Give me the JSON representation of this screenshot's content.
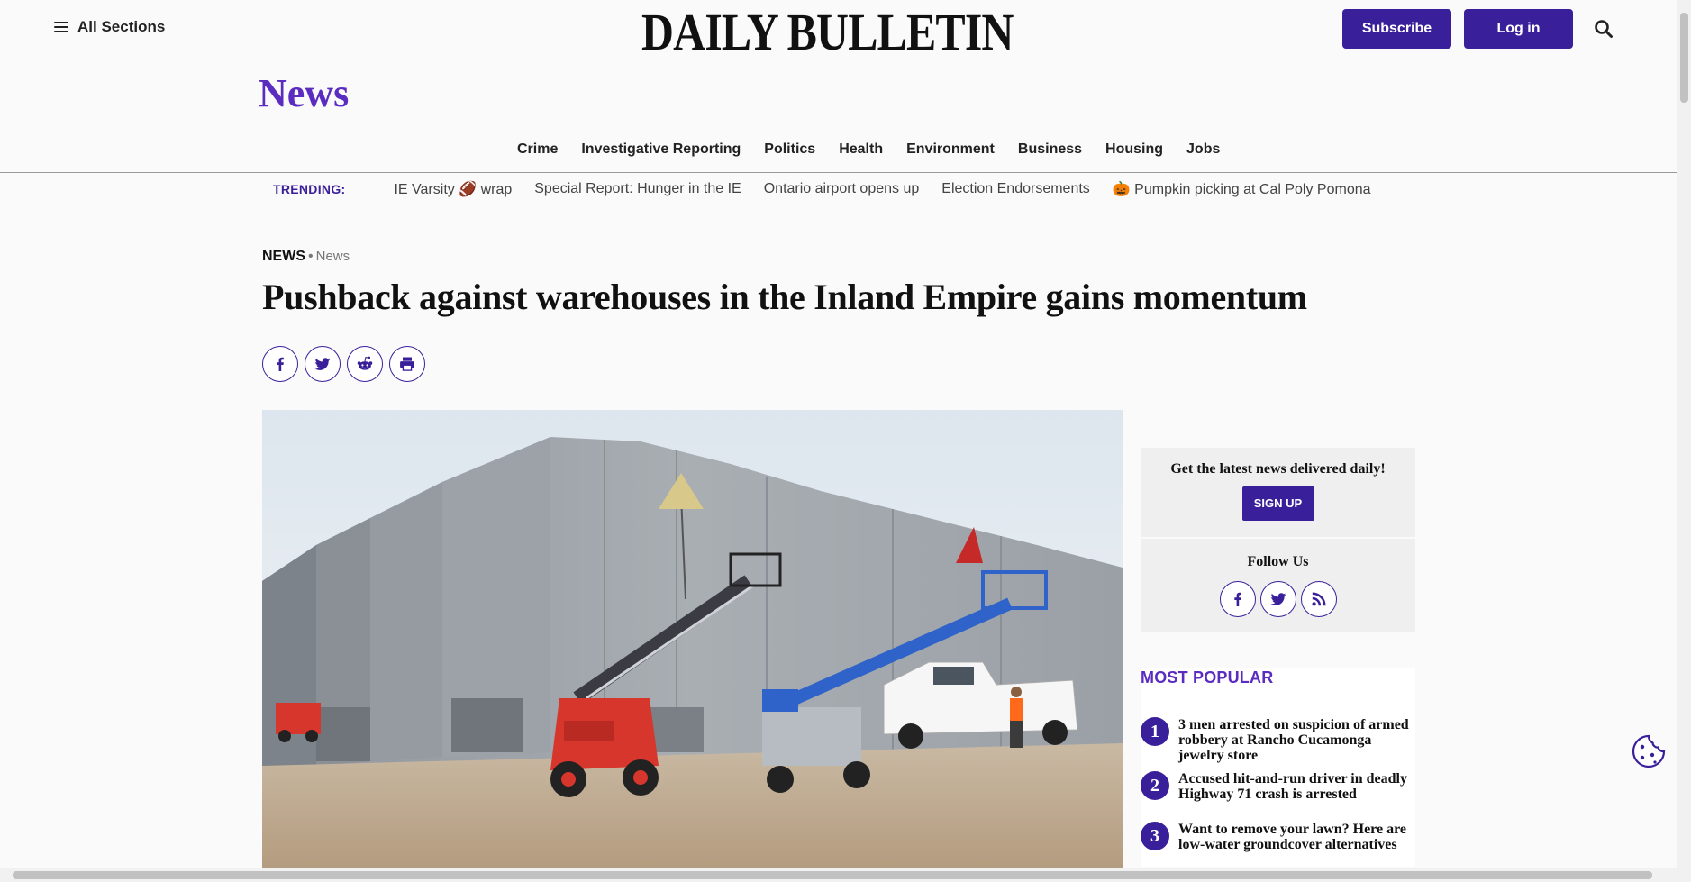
{
  "header": {
    "all_sections": "All Sections",
    "logo": "DAILY BULLETIN",
    "subscribe": "Subscribe",
    "login": "Log in"
  },
  "section_title": "News",
  "nav": [
    "Crime",
    "Investigative Reporting",
    "Politics",
    "Health",
    "Environment",
    "Business",
    "Housing",
    "Jobs"
  ],
  "trending": {
    "label": "TRENDING:",
    "items": [
      "IE Varsity 🏈 wrap",
      "Special Report: Hunger in the IE",
      "Ontario airport opens up",
      "Election Endorsements",
      "🎃 Pumpkin picking at Cal Poly Pomona"
    ]
  },
  "article": {
    "kicker_primary": "NEWS",
    "kicker_separator": "•",
    "kicker_secondary": "News",
    "headline": "Pushback against warehouses in the Inland Empire gains momentum"
  },
  "sidebar": {
    "newsletter_text": "Get the latest news delivered daily!",
    "signup": "SIGN UP",
    "follow_title": "Follow Us",
    "popular_title": "MOST POPULAR",
    "popular": [
      {
        "num": "1",
        "title": "3 men arrested on suspicion of armed robbery at Rancho Cucamonga jewelry store"
      },
      {
        "num": "2",
        "title": "Accused hit-and-run driver in deadly Highway 71 crash is arrested"
      },
      {
        "num": "3",
        "title": "Want to remove your lawn? Here are low-water groundcover alternatives"
      }
    ]
  },
  "colors": {
    "brand_purple": "#3a1f9a",
    "section_purple": "#5a2cc0"
  }
}
